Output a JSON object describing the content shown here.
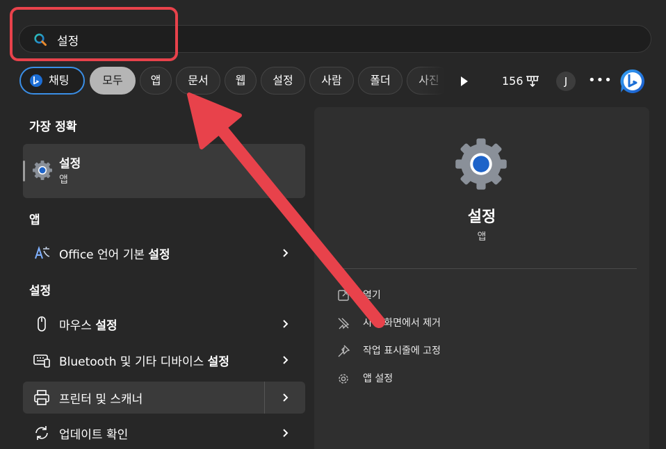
{
  "search": {
    "value": "설정",
    "placeholder": ""
  },
  "filters": {
    "chips": [
      {
        "label": "채팅"
      },
      {
        "label": "모두"
      },
      {
        "label": "앱"
      },
      {
        "label": "문서"
      },
      {
        "label": "웹"
      },
      {
        "label": "설정"
      },
      {
        "label": "사람"
      },
      {
        "label": "폴더"
      },
      {
        "label": "사진"
      }
    ],
    "selected": "모두"
  },
  "header": {
    "points": "156",
    "avatar_initial": "J",
    "more": "•••"
  },
  "left": {
    "best_match_title": "가장 정확",
    "best_match": {
      "title": "설정",
      "subtitle": "앱"
    },
    "apps_title": "앱",
    "apps": [
      {
        "label_prefix": "Office 언어 기본 ",
        "label_bold": "설정",
        "icon": "office-language-icon"
      }
    ],
    "settings_title": "설정",
    "settings": [
      {
        "label_prefix": "마우스 ",
        "label_bold": "설정",
        "icon": "mouse-icon"
      },
      {
        "label_prefix": "Bluetooth 및 기타 디바이스 ",
        "label_bold": "설정",
        "icon": "bluetooth-devices-icon"
      },
      {
        "label_prefix": "프린터 및 스캐너",
        "label_bold": "",
        "icon": "printer-icon"
      },
      {
        "label_prefix": "업데이트 확인",
        "label_bold": "",
        "icon": "update-icon"
      }
    ]
  },
  "detail": {
    "title": "설정",
    "subtitle": "앱",
    "actions": [
      {
        "label": "열기",
        "icon": "open-icon"
      },
      {
        "label": "시작 화면에서 제거",
        "icon": "unpin-icon"
      },
      {
        "label": "작업 표시줄에 고정",
        "icon": "pin-icon"
      },
      {
        "label": "앱 설정",
        "icon": "gear-icon"
      }
    ]
  },
  "colors": {
    "background": "#272727",
    "panel": "#2f2f2f",
    "accent_blue": "#3a8ee6",
    "annotation_red": "#e8424b"
  }
}
